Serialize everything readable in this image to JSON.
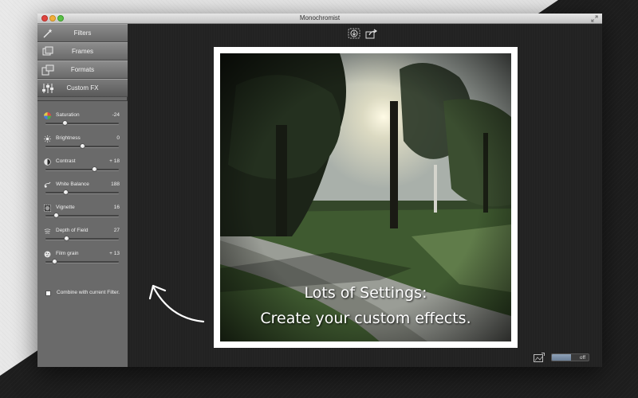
{
  "app": {
    "title": "Monochromist"
  },
  "tabs": [
    {
      "label": "Filters",
      "icon": "wand-icon"
    },
    {
      "label": "Frames",
      "icon": "frames-icon"
    },
    {
      "label": "Formats",
      "icon": "formats-icon"
    },
    {
      "label": "Custom FX",
      "icon": "sliders-icon",
      "active": true
    }
  ],
  "settings": [
    {
      "label": "Saturation",
      "value": "-24",
      "icon": "color-wheel-icon",
      "level": 0.27
    },
    {
      "label": "Brightness",
      "value": "0",
      "icon": "sun-icon",
      "level": 0.5
    },
    {
      "label": "Contrast",
      "value": "+ 18",
      "icon": "contrast-icon",
      "level": 0.67
    },
    {
      "label": "White Balance",
      "value": "188",
      "icon": "thermometer-icon",
      "level": 0.28
    },
    {
      "label": "Vignette",
      "value": "16",
      "icon": "vignette-icon",
      "level": 0.15
    },
    {
      "label": "Depth of Field",
      "value": "27",
      "icon": "depth-of-field-icon",
      "level": 0.29
    },
    {
      "label": "Film grain",
      "value": "+ 13",
      "icon": "film-grain-icon",
      "level": 0.12
    }
  ],
  "combine": {
    "label": "Combine with current Filter.",
    "checked": false
  },
  "toolbar": {
    "save_icon": "download-icon",
    "share_icon": "share-icon"
  },
  "caption": {
    "line1": "Lots of Settings:",
    "line2": "Create your custom effects."
  },
  "bottom": {
    "compare_icon": "compare-icon",
    "toggle_label": "off"
  },
  "colors": {
    "sidebar": "#6a6a6a",
    "canvas": "#222222",
    "toggle_on": "#7d91a8"
  }
}
